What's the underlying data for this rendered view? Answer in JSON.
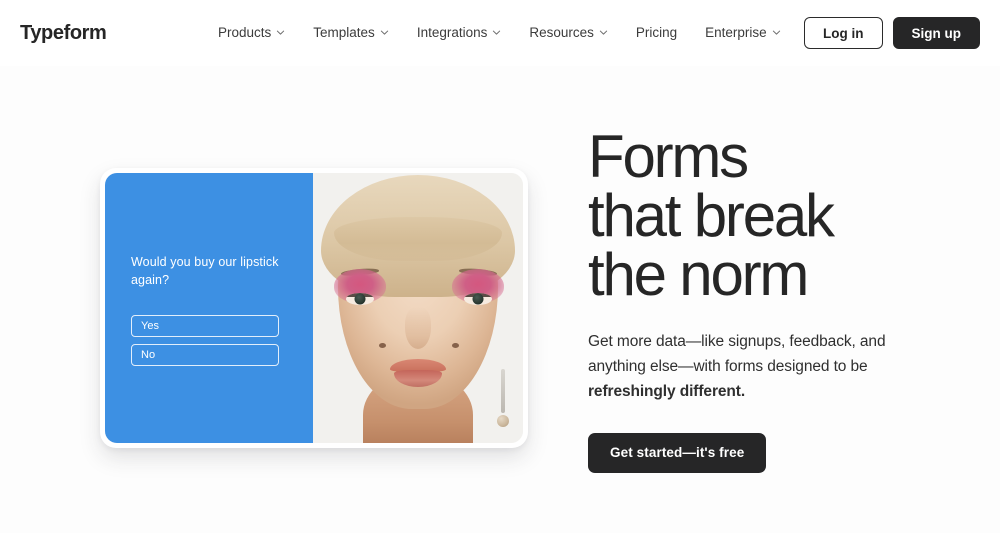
{
  "brand": {
    "name": "Typeform"
  },
  "nav": {
    "items": [
      {
        "label": "Products",
        "has_caret": true,
        "icon": "chevron-down-icon"
      },
      {
        "label": "Templates",
        "has_caret": true,
        "icon": "chevron-down-icon"
      },
      {
        "label": "Integrations",
        "has_caret": true,
        "icon": "chevron-down-icon"
      },
      {
        "label": "Resources",
        "has_caret": true,
        "icon": "chevron-down-icon"
      },
      {
        "label": "Pricing",
        "has_caret": false,
        "icon": ""
      },
      {
        "label": "Enterprise",
        "has_caret": true,
        "icon": "chevron-down-icon"
      }
    ],
    "login_label": "Log in",
    "signup_label": "Sign up"
  },
  "hero": {
    "headline": "Forms\nthat break\nthe norm",
    "subcopy_plain": "Get more data—like signups, feedback, and anything else—with forms designed to be ",
    "subcopy_bold": "refreshingly different.",
    "cta_label": "Get started—it's free"
  },
  "form_preview": {
    "question": "Would you buy\nour lipstick again?",
    "options": [
      {
        "label": "Yes"
      },
      {
        "label": "No"
      }
    ],
    "image_alt": "portrait of model with pink eyeshadow and safety pin earring"
  },
  "colors": {
    "page_background": "#fdfdfd",
    "nav_background": "#ffffff",
    "text_dark": "#262626",
    "button_dark": "#262627",
    "form_blue": "#3d90e3",
    "photo_backdrop": "#f2f1ee"
  }
}
